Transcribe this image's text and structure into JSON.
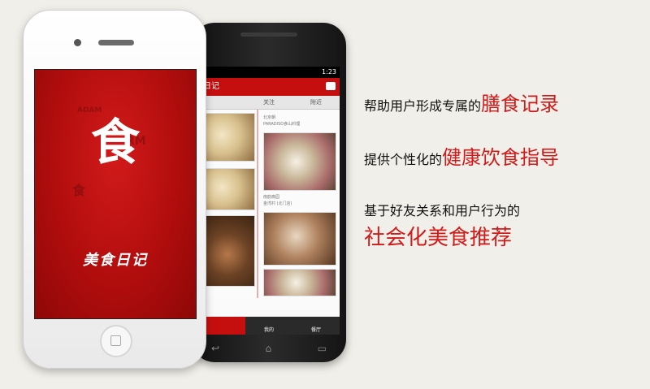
{
  "iphone_app": {
    "logo_glyph": "食",
    "app_title": "美食日记",
    "cloud_words": [
      "RM",
      "食",
      "ADAM"
    ]
  },
  "android_app": {
    "status_time": "1:23",
    "header_title": "日记",
    "tabs": [
      "",
      "关注",
      "附近"
    ],
    "captions": [
      "北京朝",
      "PARADISO食山料理",
      "南韵斋园",
      "金湾村 (北门店)"
    ],
    "bottom_nav": [
      "",
      "我的",
      "餐厅"
    ],
    "nav_keys": [
      "↩",
      "⌂",
      "▭"
    ]
  },
  "features": [
    {
      "prefix": "帮助用户形成专属的",
      "highlight": "膳食记录"
    },
    {
      "prefix": "提供个性化的",
      "highlight": "健康饮食指导"
    },
    {
      "prefix": "基于好友关系和用户行为的",
      "highlight": ""
    },
    {
      "prefix": "",
      "highlight": "社会化美食推荐"
    }
  ],
  "colors": {
    "brand_red": "#c50f0f",
    "highlight_red": "#d01b1b",
    "background": "#f1efe9"
  }
}
